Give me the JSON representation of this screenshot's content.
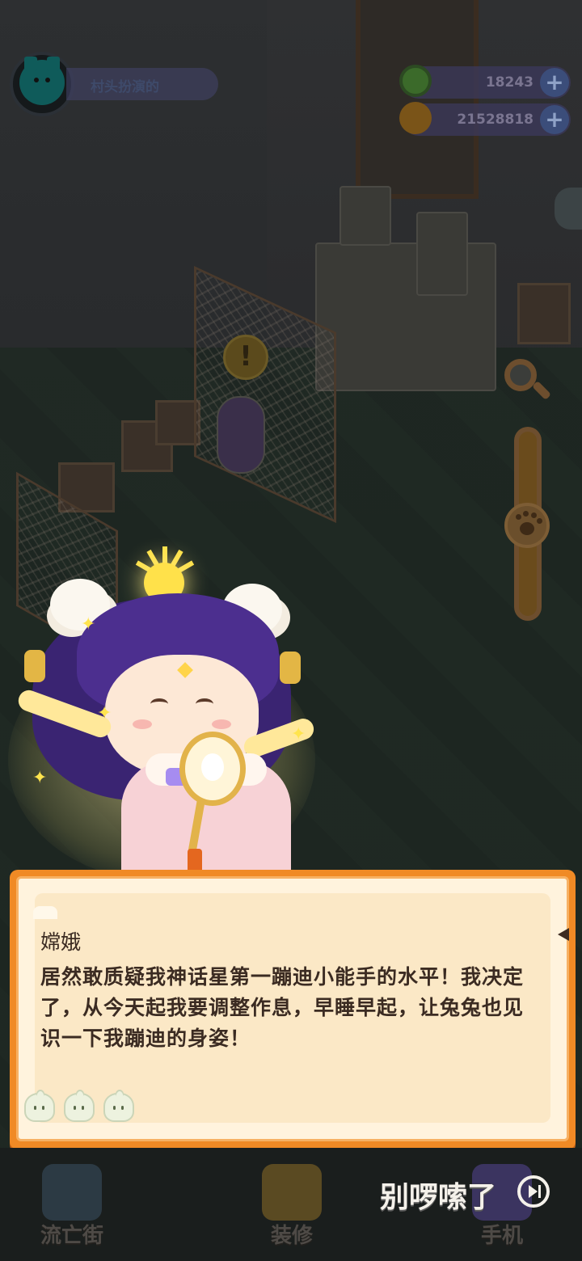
{
  "hud": {
    "player_name": "村头扮演的",
    "currencies": [
      {
        "icon": "green-donut-coin-icon",
        "value": "18243",
        "plus": "+"
      },
      {
        "icon": "planet-coin-icon",
        "value": "21528818",
        "plus": "+"
      }
    ]
  },
  "alert": {
    "symbol": "!"
  },
  "dialog": {
    "speaker": "嫦娥",
    "text": "居然敢质疑我神话星第一蹦迪小能手的水平！我决定了，从今天起我要调整作息，早睡早起，让兔兔也见识一下我蹦迪的身姿！"
  },
  "bottom_nav": [
    {
      "label": "流亡街",
      "icon": "street-icon"
    },
    {
      "label": "装修",
      "icon": "decorate-icon"
    },
    {
      "label": "手机",
      "icon": "phone-icon"
    }
  ],
  "skip": {
    "label": "别啰嗦了"
  },
  "colors": {
    "dialog_border": "#f08a25",
    "dialog_bg": "#fbe8c6",
    "text": "#3b2b22"
  }
}
